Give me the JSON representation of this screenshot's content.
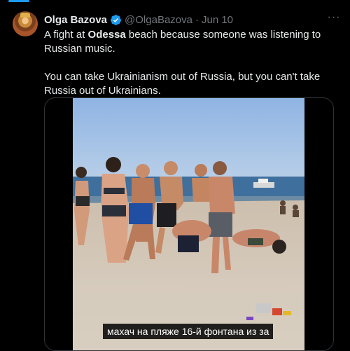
{
  "tweet": {
    "author_name": "Olga Bazova",
    "handle": "@OlgaBazova",
    "separator": "·",
    "date": "Jun 10",
    "more_label": "···",
    "text_part1": "A fight at ",
    "text_bold": "Odessa",
    "text_part2": " beach because someone was listening to Russian music.",
    "text_paragraph2": "You can take Ukrainianism out of Russia, but you can't take Russia out of Ukrainians."
  },
  "media": {
    "type": "video",
    "caption": "махач на пляже 16-й фонтана из за"
  },
  "colors": {
    "background": "#000000",
    "text": "#e7e9ea",
    "secondary_text": "#71767b",
    "accent": "#1d9bf0"
  },
  "icons": [
    "verified-badge-icon",
    "more-options-icon"
  ]
}
